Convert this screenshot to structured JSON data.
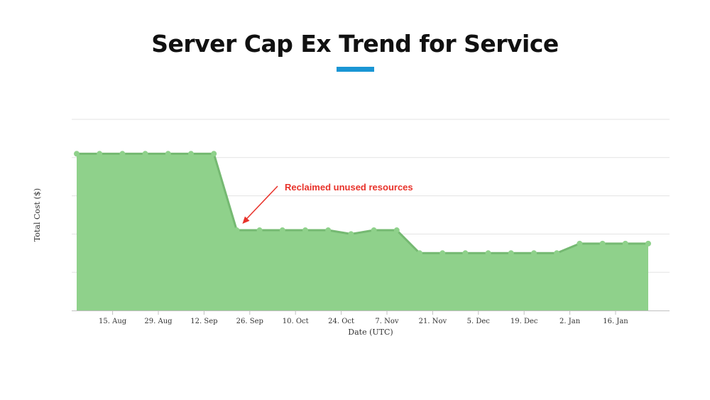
{
  "page": {
    "title": "Server Cap Ex Trend for Service",
    "accent_color": "#1a96d4"
  },
  "chart_data": {
    "type": "area",
    "xlabel": "Date (UTC)",
    "ylabel": "Total Cost ($)",
    "grid": true,
    "y_tick_labels_shown": false,
    "ylim": [
      0,
      5
    ],
    "x_ticks": [
      "15. Aug",
      "29. Aug",
      "12. Sep",
      "26. Sep",
      "10. Oct",
      "24. Oct",
      "7. Nov",
      "21. Nov",
      "5. Dec",
      "19. Dec",
      "2. Jan",
      "16. Jan"
    ],
    "x_tick_values": [
      "2016-08-15",
      "2016-08-29",
      "2016-09-12",
      "2016-09-26",
      "2016-10-10",
      "2016-10-24",
      "2016-11-07",
      "2016-11-21",
      "2016-12-05",
      "2016-12-19",
      "2017-01-02",
      "2017-01-16"
    ],
    "x_range": [
      "2016-08-04",
      "2017-01-31"
    ],
    "series": [
      {
        "color": "#8fd18b",
        "line_color": "#75b972",
        "points": [
          {
            "x": "2016-08-04",
            "y": 4.1
          },
          {
            "x": "2016-08-11",
            "y": 4.1
          },
          {
            "x": "2016-08-18",
            "y": 4.1
          },
          {
            "x": "2016-08-25",
            "y": 4.1
          },
          {
            "x": "2016-09-01",
            "y": 4.1
          },
          {
            "x": "2016-09-08",
            "y": 4.1
          },
          {
            "x": "2016-09-15",
            "y": 4.1
          },
          {
            "x": "2016-09-22",
            "y": 2.1
          },
          {
            "x": "2016-09-29",
            "y": 2.1
          },
          {
            "x": "2016-10-06",
            "y": 2.1
          },
          {
            "x": "2016-10-13",
            "y": 2.1
          },
          {
            "x": "2016-10-20",
            "y": 2.1
          },
          {
            "x": "2016-10-27",
            "y": 2.0
          },
          {
            "x": "2016-11-03",
            "y": 2.1
          },
          {
            "x": "2016-11-10",
            "y": 2.1
          },
          {
            "x": "2016-11-17",
            "y": 1.5
          },
          {
            "x": "2016-11-24",
            "y": 1.5
          },
          {
            "x": "2016-12-01",
            "y": 1.5
          },
          {
            "x": "2016-12-08",
            "y": 1.5
          },
          {
            "x": "2016-12-15",
            "y": 1.5
          },
          {
            "x": "2016-12-22",
            "y": 1.5
          },
          {
            "x": "2016-12-29",
            "y": 1.5
          },
          {
            "x": "2017-01-05",
            "y": 1.75
          },
          {
            "x": "2017-01-12",
            "y": 1.75
          },
          {
            "x": "2017-01-19",
            "y": 1.75
          },
          {
            "x": "2017-01-26",
            "y": 1.75
          }
        ]
      }
    ],
    "annotations": [
      {
        "text": "Reclaimed unused resources",
        "color": "#e8322a",
        "target": {
          "x": "2016-09-22",
          "y": 2.1
        }
      }
    ]
  }
}
